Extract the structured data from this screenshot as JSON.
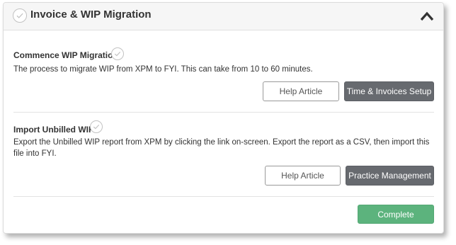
{
  "panel": {
    "title": "Invoice & WIP Migration",
    "collapse_icon": "chevron-up-icon"
  },
  "sections": [
    {
      "title": "Commence WIP Migration",
      "description": "The process to migrate WIP from XPM to FYI. This can take from 10 to 60 minutes.",
      "help_label": "Help Article",
      "action_label": "Time & Invoices Setup"
    },
    {
      "title": "Import Unbilled WIP",
      "description": "Export the Unbilled WIP report from XPM by clicking the link on-screen. Export the report as a CSV, then import this file into FYI.",
      "help_label": "Help Article",
      "action_label": "Practice Management"
    }
  ],
  "footer": {
    "complete_label": "Complete"
  },
  "colors": {
    "header_bg": "#f6f6f6",
    "dark_button": "#676a6f",
    "complete_button": "#5cb37d",
    "check_icon": "#c2c2c2"
  }
}
